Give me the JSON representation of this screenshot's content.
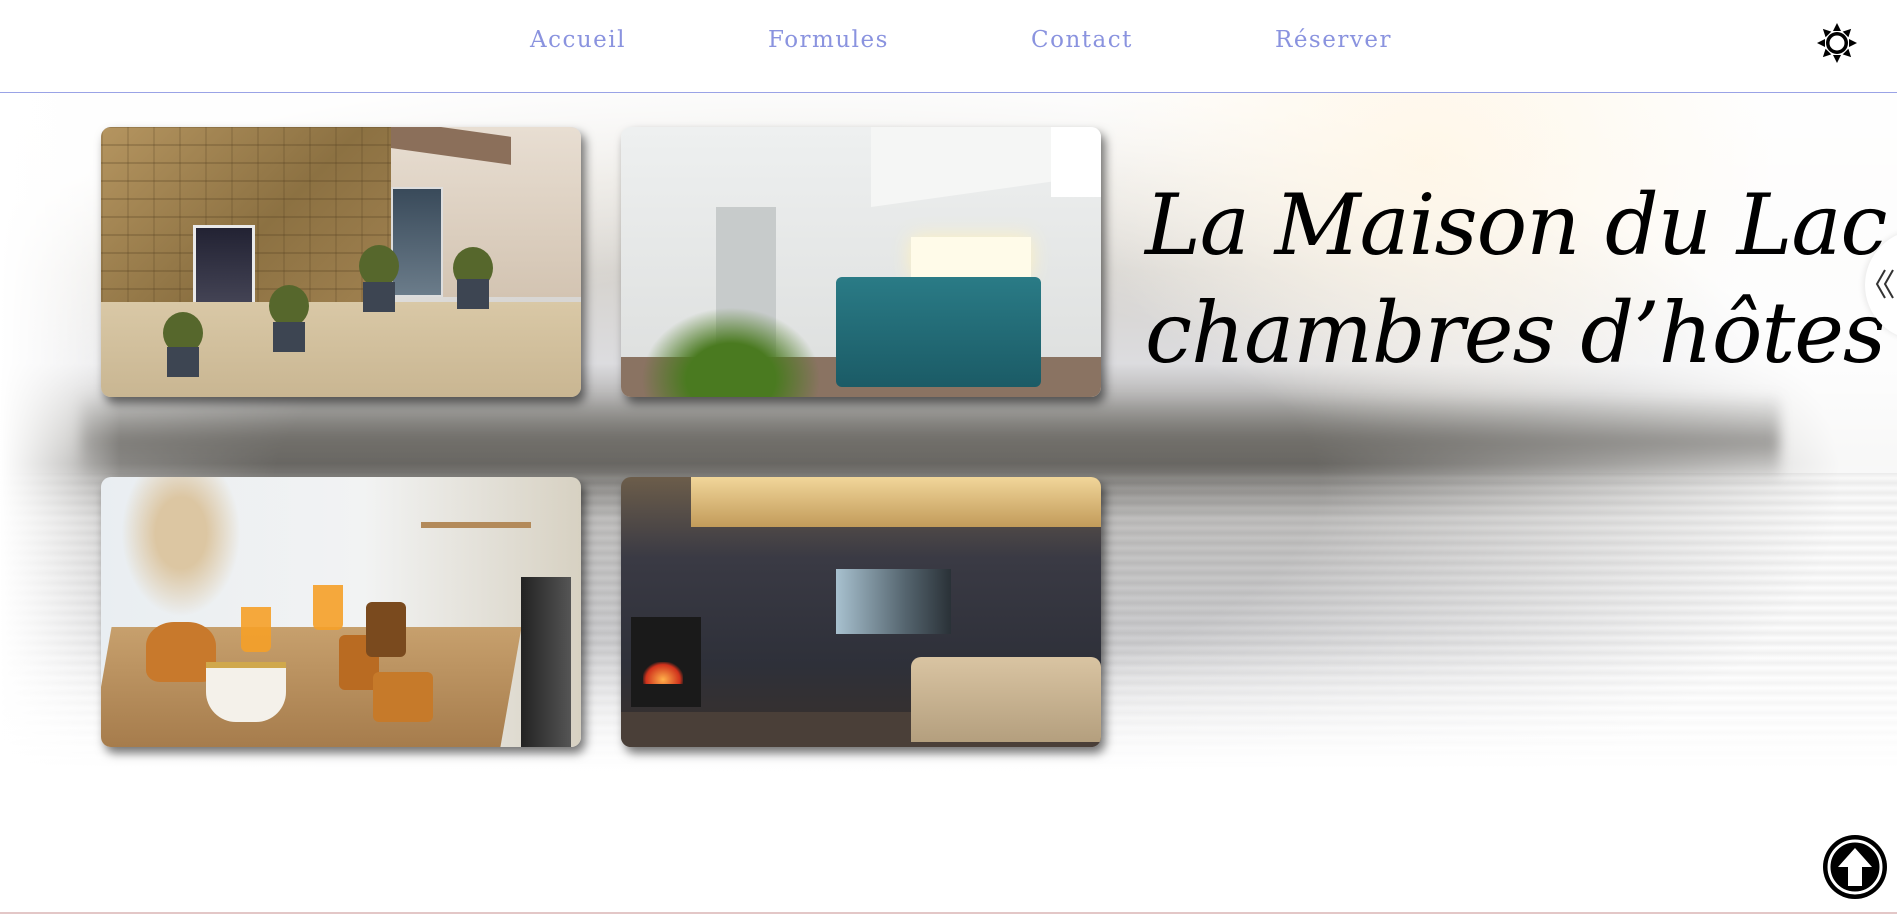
{
  "nav": {
    "items": [
      {
        "label": "Accueil"
      },
      {
        "label": "Formules"
      },
      {
        "label": "Contact"
      },
      {
        "label": "Réserver"
      }
    ],
    "theme_toggle_icon": "sun-icon"
  },
  "hero": {
    "title_line1": "La Maison du Lac,",
    "title_line2": "chambres d’hôtes",
    "photos": [
      {
        "subject": "stone house facade with courtyard"
      },
      {
        "subject": "bedroom with teal bedspread"
      },
      {
        "subject": "breakfast table with brioche and juice"
      },
      {
        "subject": "lounge with fireplace and projector screen"
      }
    ],
    "carousel_icon": "chevron-left-double-icon"
  },
  "scroll_top_icon": "arrow-up-icon",
  "colors": {
    "nav_link": "#8a93df",
    "header_border": "#9aa3e6",
    "title": "#000000"
  }
}
